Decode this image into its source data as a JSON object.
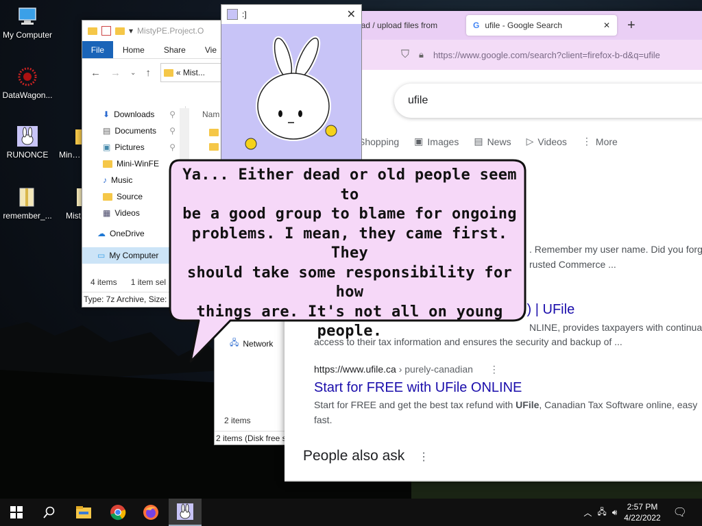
{
  "desktop_icons": [
    {
      "label": "My Computer"
    },
    {
      "label": "DataWagon..."
    },
    {
      "label": "RUNONCE"
    },
    {
      "label": "Mini-W"
    },
    {
      "label": "remember_..."
    },
    {
      "label": "Mist"
    }
  ],
  "explorer": {
    "title": "MistyPE.Project.O",
    "ribbon": {
      "file": "File",
      "home": "Home",
      "share": "Share",
      "view": "Vie"
    },
    "address": "« Mist...",
    "column_header": "Nam",
    "sidebar": [
      {
        "label": "Downloads",
        "icon": "download-icon"
      },
      {
        "label": "Documents",
        "icon": "document-icon"
      },
      {
        "label": "Pictures",
        "icon": "pictures-icon"
      },
      {
        "label": "Mini-WinFE",
        "icon": "folder-icon"
      },
      {
        "label": "Music",
        "icon": "music-icon"
      },
      {
        "label": "Source",
        "icon": "folder-icon"
      },
      {
        "label": "Videos",
        "icon": "video-icon"
      },
      {
        "label": "OneDrive",
        "icon": "cloud-icon"
      },
      {
        "label": "My Computer",
        "icon": "computer-icon"
      }
    ],
    "status_items": "4 items",
    "status_selected": "1 item sel",
    "status_type": "Type: 7z Archive, Size: 1"
  },
  "explorer2": {
    "network": "Network",
    "count": "2 items",
    "status": "2 items (Disk free sp"
  },
  "bunny_window": {
    "title": ":]"
  },
  "speech": {
    "lines": [
      "Ya... Either dead or old people seem to",
      "be a good group to blame for ongoing",
      "problems. I mean, they came first. They",
      "should take some responsibility for how",
      "things are. It's not all on young people."
    ]
  },
  "browser": {
    "tab1": "oad / upload files from",
    "tab2": "ufile - Google Search",
    "url_host": "https://www.google.com",
    "url_path": "/search?client=firefox-b-d&q=ufile",
    "search_query": "ufile",
    "tabs": [
      "Shopping",
      "Images",
      "News",
      "Videos",
      "More"
    ],
    "result1_snippet_a": ". Remember my user name. Did you forg",
    "result1_snippet_b": "rusted Commerce ...",
    "result2_title": ".) | UFile",
    "result2_snippet_a": "NLINE, provides taxpayers with continual",
    "result2_snippet_b": "access to their tax information and ensures the security and backup of ...",
    "result3_url": "https://www.ufile.ca",
    "result3_breadcrumb": " › purely-canadian",
    "result3_title": "Start for FREE with UFile ONLINE",
    "result3_snippet_a_pre": "Start for FREE and get the best tax refund with ",
    "result3_snippet_a_bold": "UFile",
    "result3_snippet_a_post": ", Canadian Tax Software online, easy",
    "result3_snippet_b": "fast.",
    "people_also_ask": "People also ask"
  },
  "taskbar": {
    "time": "2:57 PM",
    "date": "4/22/2022"
  }
}
